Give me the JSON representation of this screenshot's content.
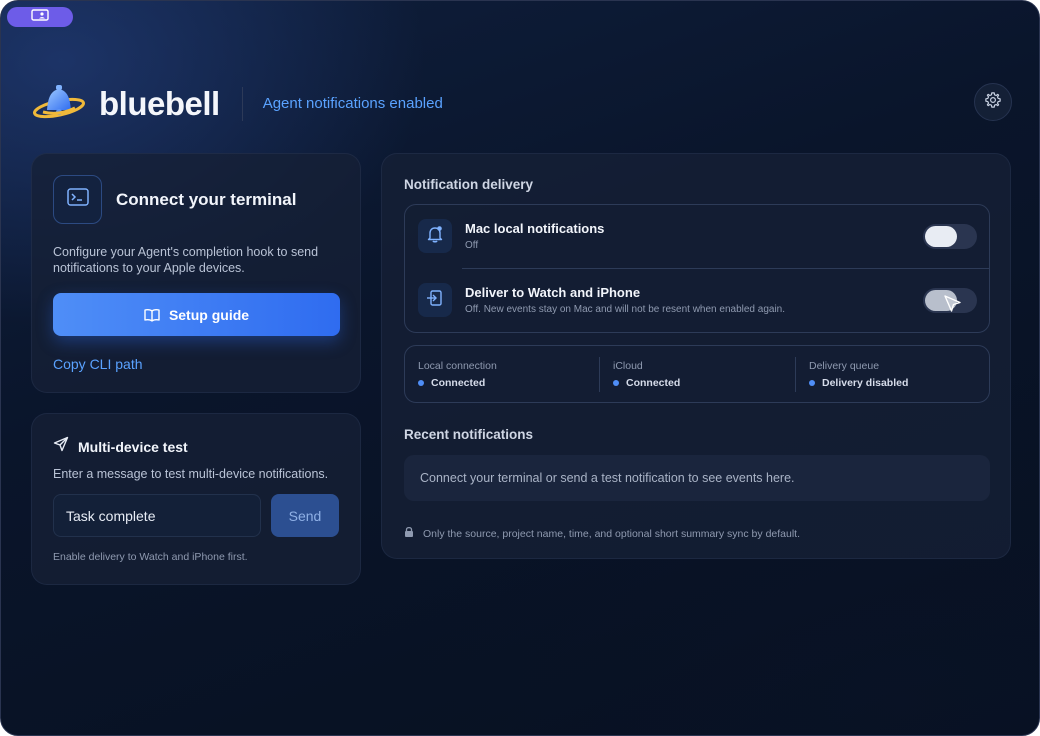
{
  "brand": {
    "name": "bluebell",
    "status": "Agent notifications enabled"
  },
  "terminal_card": {
    "title": "Connect your terminal",
    "description": "Configure your Agent's completion hook to send notifications to your Apple devices.",
    "setup_button": "Setup guide",
    "copy_link": "Copy CLI path"
  },
  "test_card": {
    "title": "Multi-device test",
    "description": "Enter a message to test multi-device notifications.",
    "input_value": "Task complete",
    "send_button": "Send",
    "hint": "Enable delivery to Watch and iPhone first."
  },
  "delivery": {
    "title": "Notification delivery",
    "rows": [
      {
        "title": "Mac local notifications",
        "subtitle": "Off",
        "enabled": false
      },
      {
        "title": "Deliver to Watch and iPhone",
        "subtitle": "Off. New events stay on Mac and will not be resent when enabled again.",
        "enabled": false
      }
    ],
    "status": [
      {
        "label": "Local connection",
        "value": "Connected"
      },
      {
        "label": "iCloud",
        "value": "Connected"
      },
      {
        "label": "Delivery queue",
        "value": "Delivery disabled"
      }
    ],
    "recent_title": "Recent notifications",
    "recent_empty": "Connect your terminal or send a test notification to see events here.",
    "footnote": "Only the source, project name, time, and optional short summary sync by default."
  },
  "colors": {
    "accent": "#4f8ef7",
    "link": "#5aa2ff",
    "pill": "#6d5ce8"
  },
  "icons": {
    "window_pill": "window-user-icon",
    "logo": "bell-logo-icon",
    "settings": "gear-icon",
    "terminal": "terminal-icon",
    "setup": "book-icon",
    "test": "paper-plane-icon",
    "mac_row": "bell-icon",
    "watch_row": "sign-in-icon",
    "footnote": "lock-icon"
  }
}
